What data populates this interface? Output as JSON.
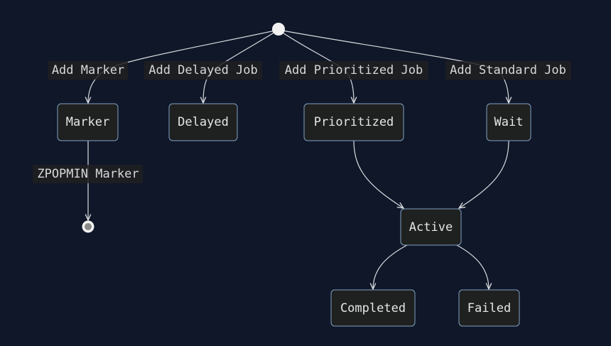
{
  "diagram": {
    "type": "state-diagram",
    "states": {
      "marker": "Marker",
      "delayed": "Delayed",
      "prioritized": "Prioritized",
      "wait": "Wait",
      "active": "Active",
      "completed": "Completed",
      "failed": "Failed"
    },
    "transitions": {
      "add_marker": "Add Marker",
      "add_delayed_job": "Add Delayed Job",
      "add_prioritized_job": "Add Prioritized Job",
      "add_standard_job": "Add Standard Job",
      "zpopmin_marker": "ZPOPMIN Marker"
    },
    "colors": {
      "background": "#0f1729",
      "node_fill": "#1f2020",
      "node_border": "#81a1c1",
      "edge": "#d8dadd",
      "text": "#e6e6e6"
    }
  }
}
